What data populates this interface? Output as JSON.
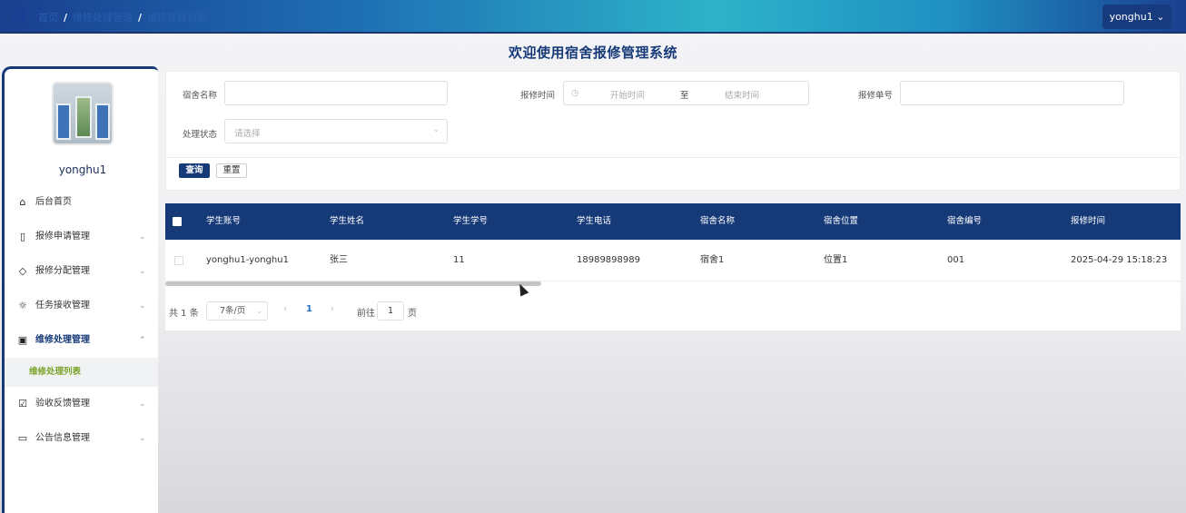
{
  "topbar": {
    "breadcrumb": [
      "首页",
      "维修处理管理",
      "维修处理列表"
    ],
    "separator": "/",
    "user_button": "yonghu1 ⌄"
  },
  "page_title": "欢迎使用宿舍报修管理系统",
  "sidebar": {
    "username": "yonghu1",
    "items": [
      {
        "label": "后台首页",
        "icon": "home-icon"
      },
      {
        "label": "报修申请管理",
        "icon": "bookmark-icon",
        "chevron": "⌄"
      },
      {
        "label": "报修分配管理",
        "icon": "tag-icon",
        "chevron": "⌄"
      },
      {
        "label": "任务接收管理",
        "icon": "sun-icon",
        "chevron": "⌄"
      },
      {
        "label": "维修处理管理",
        "icon": "inbox-icon",
        "chevron": "⌃",
        "active": true
      },
      {
        "label": "验收反馈管理",
        "icon": "clipboard-check-icon",
        "chevron": "⌄"
      },
      {
        "label": "公告信息管理",
        "icon": "message-icon",
        "chevron": "⌄"
      }
    ],
    "subitem": "维修处理列表"
  },
  "search": {
    "dorm_name_label": "宿舍名称",
    "dorm_name_value": "",
    "repair_time_label": "报修时间",
    "start_placeholder": "开始时间",
    "range_sep": "至",
    "end_placeholder": "结束时间",
    "repair_no_label": "报修单号",
    "repair_no_value": "",
    "status_label": "处理状态",
    "status_placeholder": "请选择",
    "query_button": "查询",
    "reset_button": "重置"
  },
  "table": {
    "columns": [
      "学生账号",
      "学生姓名",
      "学生学号",
      "学生电话",
      "宿舍名称",
      "宿舍位置",
      "宿舍编号",
      "报修时间"
    ],
    "rows": [
      [
        "yonghu1-yonghu1",
        "张三",
        "11",
        "18989898989",
        "宿舍1",
        "位置1",
        "001",
        "2025-04-29 15:18:23"
      ]
    ]
  },
  "pagination": {
    "total": "共 1 条",
    "page_size": "7条/页",
    "prev": "‹",
    "current": "1",
    "next": "›",
    "goto_label": "前往",
    "goto_value": "1",
    "page_label": "页"
  }
}
